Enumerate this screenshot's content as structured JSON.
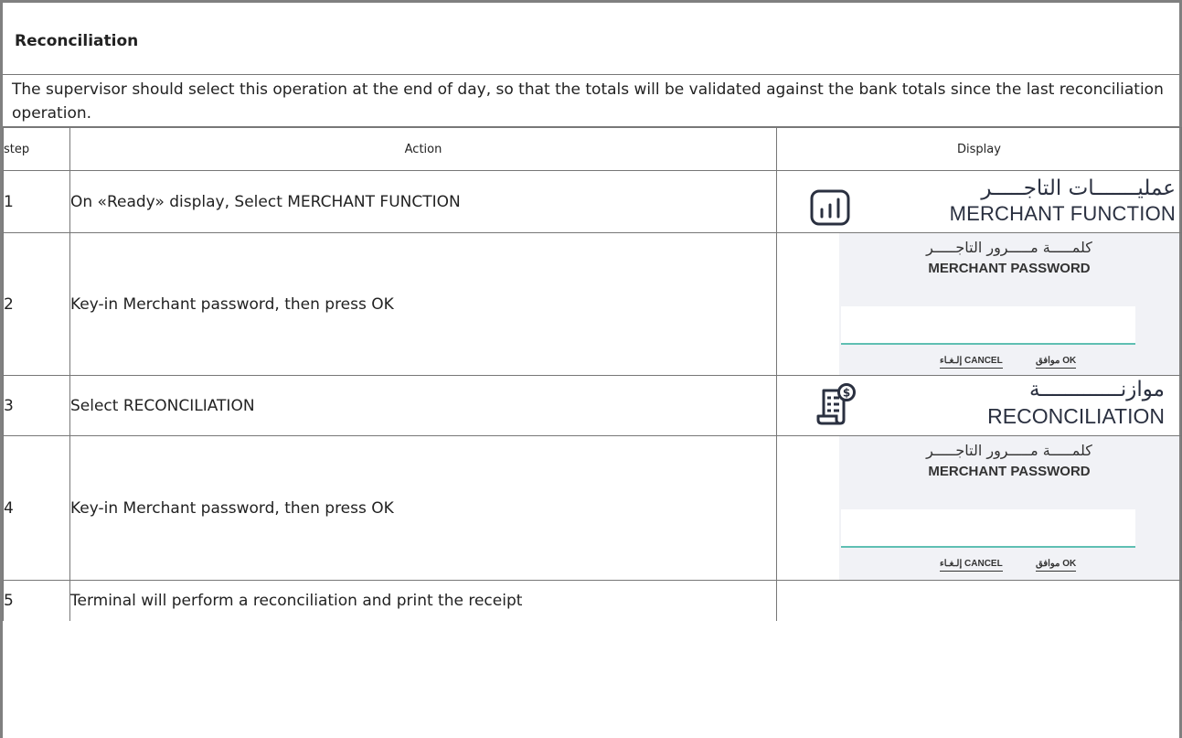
{
  "section": {
    "title": "Reconciliation",
    "description": "The supervisor should select this operation at the end of day, so that the totals will be validated against the bank totals since the last reconciliation operation."
  },
  "table": {
    "headers": {
      "step": "step",
      "action": "Action",
      "display": "Display"
    },
    "rows": [
      {
        "step": "1",
        "action": "On «Ready» display, Select MERCHANT FUNCTION"
      },
      {
        "step": "2",
        "action": "Key-in Merchant password, then press OK"
      },
      {
        "step": "3",
        "action": "Select RECONCILIATION"
      },
      {
        "step": "4",
        "action": "Key-in Merchant password, then press OK"
      },
      {
        "step": "5",
        "action": "Terminal will perform a reconciliation and print the receipt"
      }
    ]
  },
  "displays": {
    "merchant_function": {
      "arabic": "عمليـــــــات التاجـــــر",
      "english": "MERCHANT FUNCTION",
      "icon": "bar-chart-icon"
    },
    "password_prompt": {
      "arabic": "كلمـــــة مـــــرور التاجـــــر",
      "english": "MERCHANT PASSWORD",
      "cancel_label": "إلـغـاء CANCEL",
      "ok_label": "موافق OK"
    },
    "reconciliation": {
      "arabic": "موازنـــــــــــــة",
      "english": "RECONCILIATION",
      "icon": "receipt-dollar-icon"
    }
  },
  "colors": {
    "icon_stroke": "#2a3040",
    "input_underline": "#5fbfb3",
    "panel_bg": "#f1f2f6",
    "border": "#777777"
  }
}
